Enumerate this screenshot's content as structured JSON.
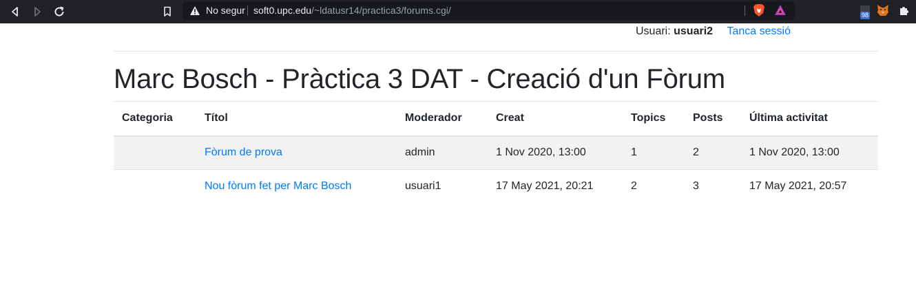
{
  "browser": {
    "security_label": "No segur",
    "url_host": "soft0.upc.edu",
    "url_path": "/~ldatusr14/practica3/forums.cgi/",
    "extension_badge": "98",
    "icons": [
      "back-icon",
      "forward-icon",
      "reload-icon",
      "bookmark-icon",
      "warning-icon",
      "brave-shield-icon",
      "brave-rewards-icon",
      "extension-icon",
      "metamask-icon",
      "puzzle-icon"
    ]
  },
  "header": {
    "user_label": "Usuari:",
    "username": "usuari2",
    "logout": "Tanca sessió"
  },
  "page": {
    "title": "Marc Bosch - Pràctica 3 DAT - Creació d'un Fòrum"
  },
  "table": {
    "columns": [
      "Categoria",
      "Títol",
      "Moderador",
      "Creat",
      "Topics",
      "Posts",
      "Última activitat"
    ],
    "rows": [
      {
        "category": "",
        "title": "Fòrum de prova",
        "moderator": "admin",
        "created": "1 Nov 2020, 13:00",
        "topics": "1",
        "posts": "2",
        "last_activity": "1 Nov 2020, 13:00"
      },
      {
        "category": "",
        "title": "Nou fòrum fet per Marc Bosch",
        "moderator": "usuari1",
        "created": "17 May 2021, 20:21",
        "topics": "2",
        "posts": "3",
        "last_activity": "17 May 2021, 20:57"
      }
    ]
  },
  "colors": {
    "chrome_bg": "#202124",
    "link": "#007bff",
    "striped_row": "#f2f2f2"
  }
}
